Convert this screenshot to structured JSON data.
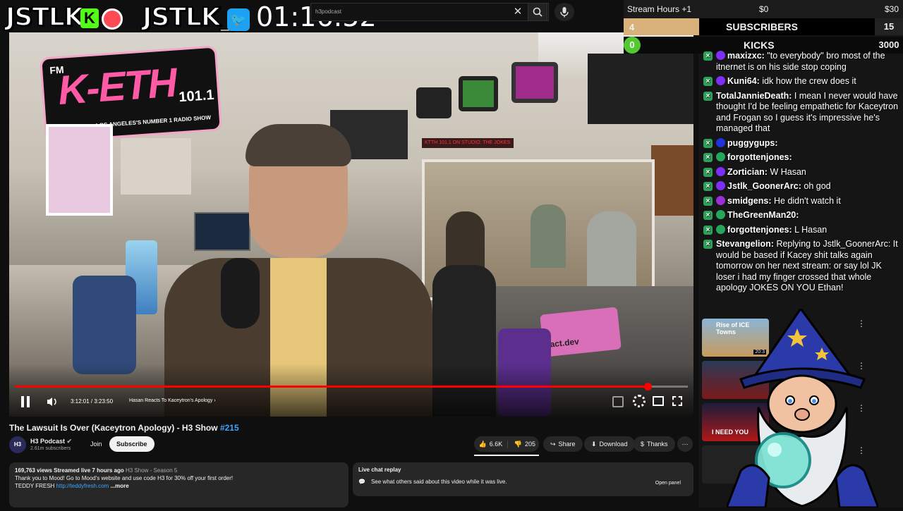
{
  "topbar": {
    "logo1": "JSTLK",
    "logo2": "JSTLK_",
    "clock": "01:16:52",
    "search_value": "h3podcast"
  },
  "video": {
    "station_sign": "K-ETH",
    "station_freq": "101.1",
    "station_fm": "FM",
    "station_tagline": "LOS ANGELES'S NUMBER 1 RADIO SHOW",
    "sticker": "act.dev",
    "time": "3:12:01 / 3:23:50",
    "chapter": "Hasan Reacts To Kaceytron's Apology",
    "progress": 0.94
  },
  "meta": {
    "title": "The Lawsuit Is Over (Kaceytron Apology) - H3 Show",
    "title_tag": "#215",
    "channel": "H3 Podcast",
    "channel_avatar": "H3",
    "subs": "2.61m subscribers",
    "join": "Join",
    "subscribe": "Subscribe",
    "likes": "6.6K",
    "dislikes": "205",
    "share": "Share",
    "download": "Download",
    "thanks": "Thanks"
  },
  "description": {
    "stats": "169,763 views  Streamed live 7 hours ago",
    "series": "H3 Show - Season 5",
    "line1": "Thank you to Mood! Go to Mood's website and use code H3 for 30% off your first order!",
    "line2a": "TEDDY FRESH",
    "link": "http://teddyfresh.com",
    "more": "...more"
  },
  "livechat": {
    "header": "Live chat replay",
    "body": "See what others said about this video while it was live.",
    "button": "Open panel"
  },
  "stats": {
    "row1_label": "Stream Hours +1",
    "row1_min": "$0",
    "row1_max": "$30",
    "subs_count": "4",
    "subs_label": "SUBSCRIBERS",
    "subs_goal": "15",
    "kicks_count": "0",
    "kicks_label": "KICKS",
    "kicks_goal": "3000",
    "subs_progress": 0.27
  },
  "chat": [
    {
      "user": "maxizxc:",
      "text": "\"to everybody\" bro most of the itnernet is on his side stop coping",
      "color": "#7b2ff7"
    },
    {
      "user": "Kuni64:",
      "text": "idk how the crew does it",
      "color": "#7b2ff7"
    },
    {
      "user": "TotalJannieDeath:",
      "text": "I mean I never would have thought I'd be feeling empathetic for Kaceytron and Frogan so I guess it's impressive he's managed that",
      "color": ""
    },
    {
      "user": "puggygups:",
      "text": "",
      "color": "#2233dd"
    },
    {
      "user": "forgottenjones:",
      "text": "",
      "color": "#26a65b"
    },
    {
      "user": "Zortician:",
      "text": "W Hasan",
      "color": "#7b2ff7"
    },
    {
      "user": "Jstlk_GoonerArc:",
      "text": "oh god",
      "color": "#7b2ff7"
    },
    {
      "user": "smidgens:",
      "text": "He didn't watch it",
      "color": "#9b2fd7"
    },
    {
      "user": "TheGreenMan20:",
      "text": "",
      "color": "#26a65b"
    },
    {
      "user": "forgottenjones:",
      "text": "L Hasan",
      "color": "#26a65b"
    },
    {
      "user": "Stevangelion:",
      "text": "Replying to Jstlk_GoonerArc: It would be based if Kacey shit talks again tomorrow on her next stream",
      "text2": ": or say lol JK loser i had my finger crossed that whole apology JOKES ON YOU Ethan!",
      "color": ""
    }
  ],
  "recs": [
    {
      "title": "Rise of ICE Towns",
      "dur": "20:3"
    },
    {
      "title": "I NEED YOU",
      "dur": ""
    }
  ],
  "colors": {
    "accent": "#ff0000",
    "chat_badge": "#2da05a",
    "stats_bar": "#d8b27a"
  }
}
